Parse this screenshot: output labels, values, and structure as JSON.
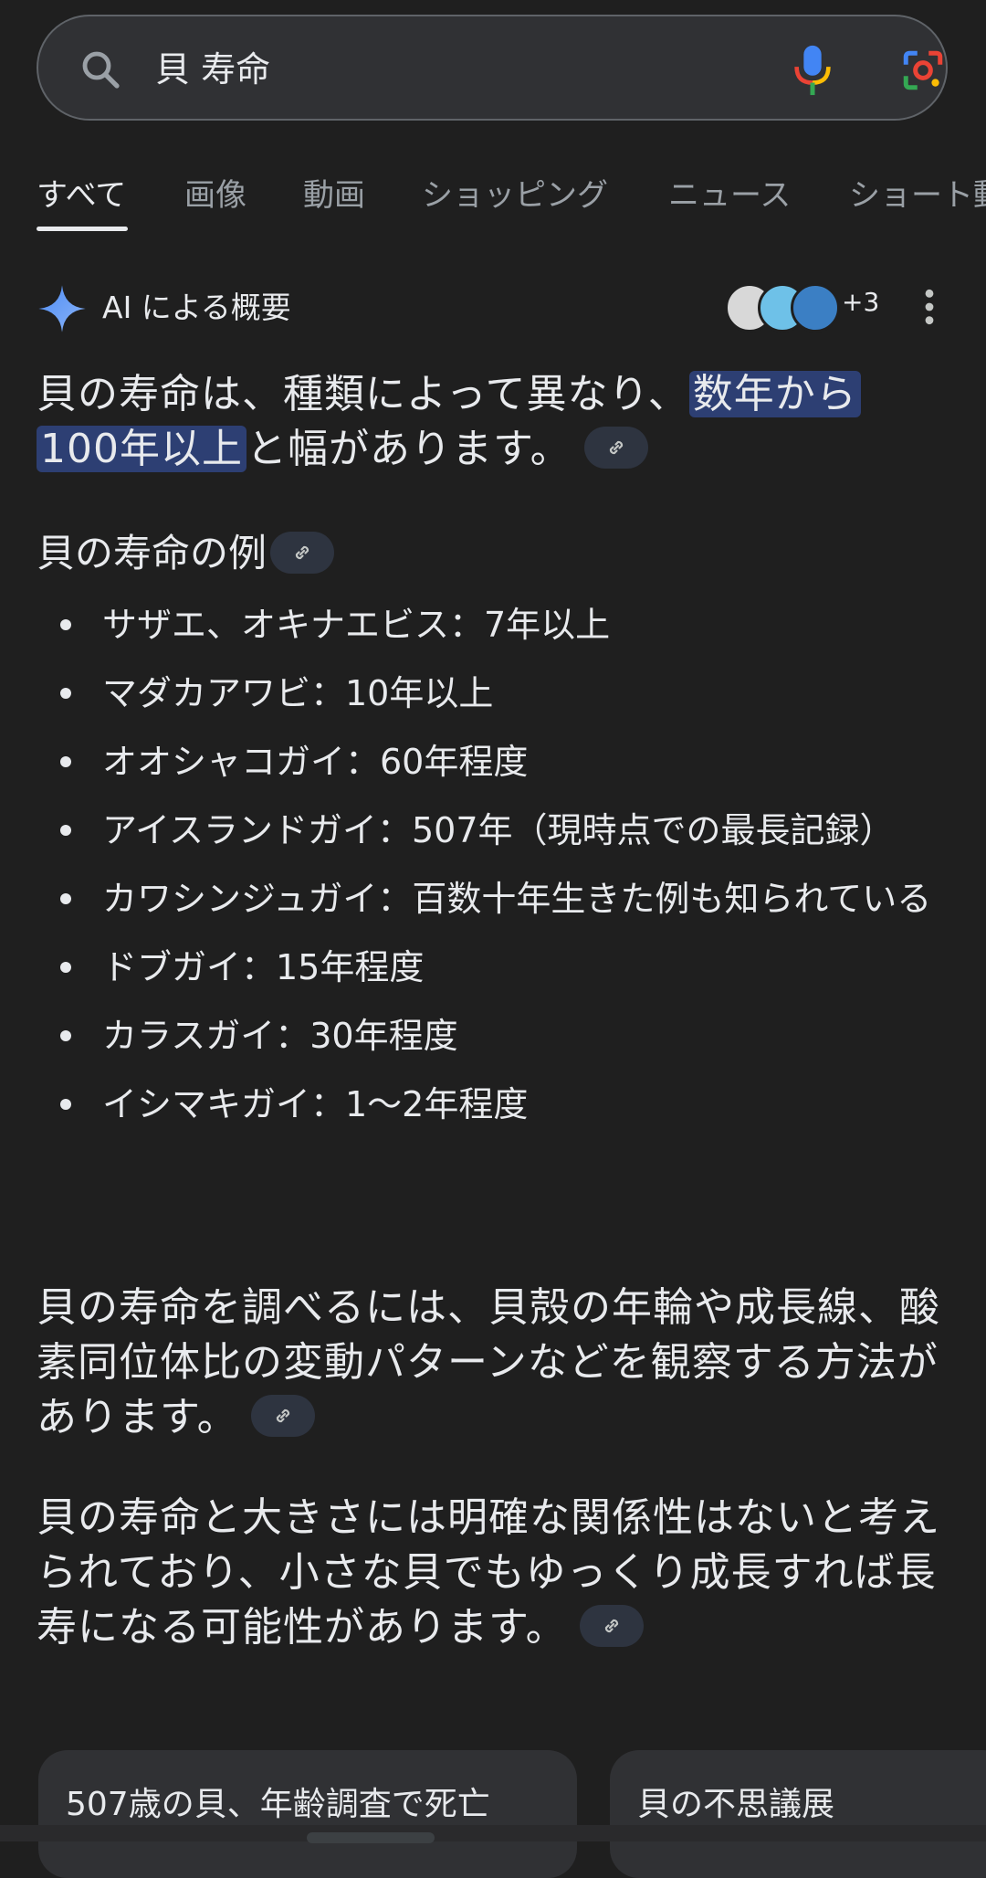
{
  "search": {
    "query": "貝 寿命"
  },
  "tabs": [
    {
      "label": "すべて"
    },
    {
      "label": "画像"
    },
    {
      "label": "動画"
    },
    {
      "label": "ショッピング"
    },
    {
      "label": "ニュース"
    },
    {
      "label": "ショート動"
    }
  ],
  "ai_overview": {
    "title": "AI による概要",
    "sources_more": "+3",
    "intro_before": "貝の寿命は、種類によって異なり、",
    "intro_highlight_1": "数年から",
    "intro_highlight_2": "100年以上",
    "intro_after": "と幅があります。",
    "examples_heading": "貝の寿命の例",
    "examples": [
      {
        "text": "サザエ、オキナエビス：7年以上"
      },
      {
        "text": "マダカアワビ：10年以上"
      },
      {
        "text": "オオシャコガイ：60年程度"
      },
      {
        "text": "アイスランドガイ：507年（現時点での最長記録）"
      },
      {
        "text": "カワシンジュガイ：百数十年生きた例も知られている"
      },
      {
        "text": "ドブガイ：15年程度"
      },
      {
        "text": "カラスガイ：30年程度"
      },
      {
        "text": "イシマキガイ：1〜2年程度"
      }
    ],
    "method_text": "貝の寿命を調べるには、貝殻の年輪や成長線、酸素同位体比の変動パターンなどを観察する方法があります。",
    "size_text": "貝の寿命と大きさには明確な関係性はないと考えられており、小さな貝でもゆっくり成長すれば長寿になる可能性があります。"
  },
  "cards": [
    {
      "title": "507歳の貝、年齢調査で死亡"
    },
    {
      "title": "貝の不思議展"
    }
  ],
  "colors": {
    "background": "#1f1f1f",
    "highlight": "#2d3f73",
    "text": "#e8eaed",
    "muted": "#9aa0a6"
  }
}
